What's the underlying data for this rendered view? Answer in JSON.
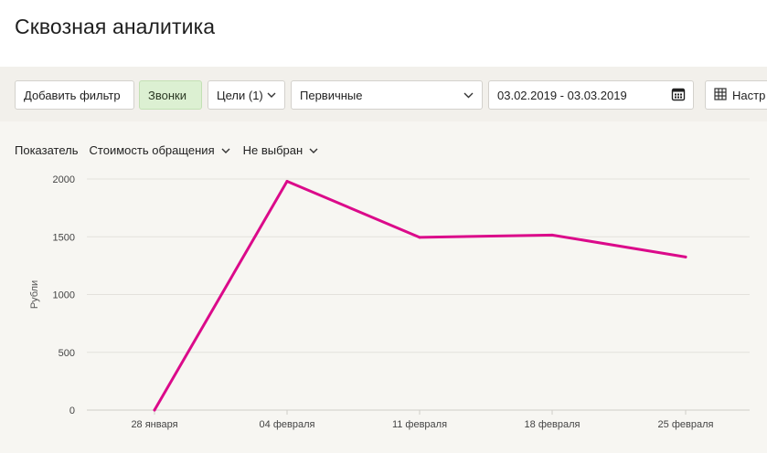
{
  "page": {
    "title": "Сквозная аналитика"
  },
  "toolbar": {
    "add_filter": "Добавить фильтр",
    "calls": "Звонки",
    "goals": "Цели (1)",
    "primary": "Первичные",
    "date_range": "03.02.2019 - 03.03.2019",
    "settings": "Настр"
  },
  "metrics": {
    "label": "Показатель",
    "selected": "Стоимость обращения",
    "second": "Не выбран"
  },
  "colors": {
    "series": "#db0a8a",
    "calls_bg": "#dcf0d2",
    "toolbar_bg": "#f2f0eb",
    "content_bg": "#f7f6f2"
  },
  "chart_data": {
    "type": "line",
    "title": "",
    "xlabel": "",
    "ylabel": "Рубли",
    "categories": [
      "28 января",
      "04 февраля",
      "11 февраля",
      "18 февраля",
      "25 февраля"
    ],
    "series": [
      {
        "values": [
          0,
          1980,
          1495,
          1515,
          1325
        ]
      }
    ],
    "ylim": [
      0,
      2000
    ],
    "yticks": [
      0,
      500,
      1000,
      1500,
      2000
    ],
    "grid": true,
    "legend": "none"
  }
}
